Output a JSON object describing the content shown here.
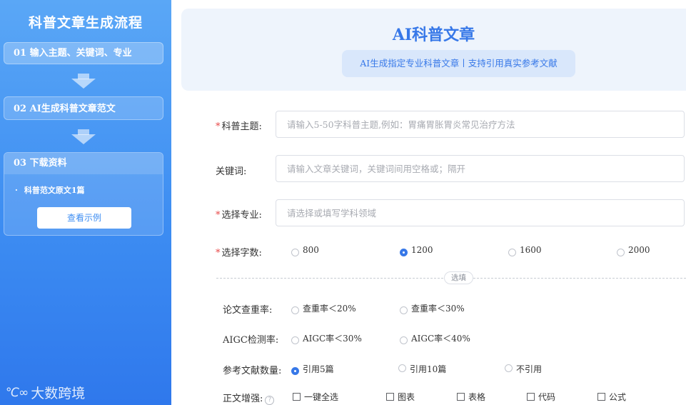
{
  "sidebar": {
    "title": "科普文章生成流程",
    "steps": [
      {
        "label": "01 输入主题、关键词、专业"
      },
      {
        "label": "02 AI生成科普文章范文"
      },
      {
        "label": "03 下载资料"
      }
    ],
    "download_item": "科普范文原文1篇",
    "example_button": "查看示例",
    "brand": "大数跨境",
    "brand_logo": "℃∞"
  },
  "header": {
    "title": "AI科普文章",
    "subtitle": "AI生成指定专业科普文章丨支持引用真实参考文献"
  },
  "form": {
    "topic": {
      "label": "科普主题:",
      "placeholder": "请输入5-50字科普主题,例如：胃痛胃胀胃炎常见治疗方法",
      "required": true
    },
    "keywords": {
      "label": "关键词:",
      "placeholder": "请输入文章关键词，关键词间用空格或；隔开"
    },
    "major": {
      "label": "选择专业:",
      "placeholder": "请选择或填写学科领域",
      "required": true
    },
    "word_count": {
      "label": "选择字数:",
      "options": [
        "800",
        "1200",
        "1600",
        "2000"
      ],
      "selected": "1200",
      "required": true
    },
    "optional_tag": "选填",
    "plagiarism": {
      "label": "论文查重率:",
      "options": [
        "查重率＜20%",
        "查重率＜30%"
      ]
    },
    "aigc": {
      "label": "AIGC检测率:",
      "options": [
        "AIGC率＜30%",
        "AIGC率＜40%"
      ]
    },
    "references": {
      "label": "参考文献数量:",
      "options": [
        "引用5篇",
        "引用10篇",
        "不引用"
      ],
      "selected": "引用5篇"
    },
    "enhance": {
      "label": "正文增强:",
      "help": "?",
      "options": [
        "一键全选",
        "图表",
        "表格",
        "代码",
        "公式"
      ]
    }
  },
  "colors": {
    "accent": "#3778e8",
    "sidebar_top": "#5aa7f6",
    "sidebar_bottom": "#2f78ec",
    "required": "#e84a4a"
  }
}
